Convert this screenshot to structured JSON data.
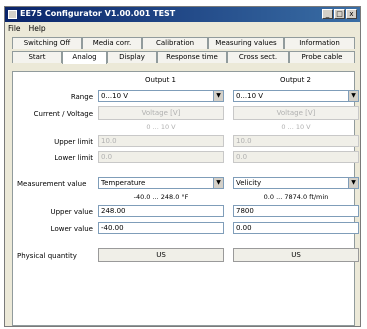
{
  "window": {
    "title": "EE75 Configurator V1.00.001 TEST",
    "controls": {
      "minimize": "_",
      "maximize": "□",
      "close": "x"
    }
  },
  "menu": [
    "File",
    "Help"
  ],
  "tabs_row1": [
    "Switching Off",
    "Media corr.",
    "Calibration",
    "Measuring values",
    "Information"
  ],
  "tabs_row2": [
    "Start",
    "Analog",
    "Display",
    "Response time",
    "Cross sect.",
    "Probe cable"
  ],
  "active_tab": "Analog",
  "outputs": {
    "output1_label": "Output 1",
    "output2_label": "Output 2"
  },
  "labels": {
    "range": "Range",
    "current_voltage": "Current / Voltage",
    "upper_limit": "Upper limit",
    "lower_limit": "Lower limit",
    "measurement_value": "Measurement value",
    "upper_value": "Upper value",
    "lower_value": "Lower value",
    "physical_quantity": "Physical quantity"
  },
  "output1": {
    "range": "0...10 V",
    "cv_button": "Voltage [V]",
    "cv_range": "0 ... 10 V",
    "upper_limit": "10.0",
    "lower_limit": "0.0",
    "measurement": "Temperature",
    "meas_range": "-40.0 ... 248.0 °F",
    "upper_value": "248.00",
    "lower_value": "-40.00",
    "physical_button": "US"
  },
  "output2": {
    "range": "0...10 V",
    "cv_button": "Voltage [V]",
    "cv_range": "0 ... 10 V",
    "upper_limit": "10.0",
    "lower_limit": "0.0",
    "measurement": "Velicity",
    "meas_range": "0.0 ... 7874.0 ft/min",
    "upper_value": "7800",
    "lower_value": "0.00",
    "physical_button": "US"
  }
}
